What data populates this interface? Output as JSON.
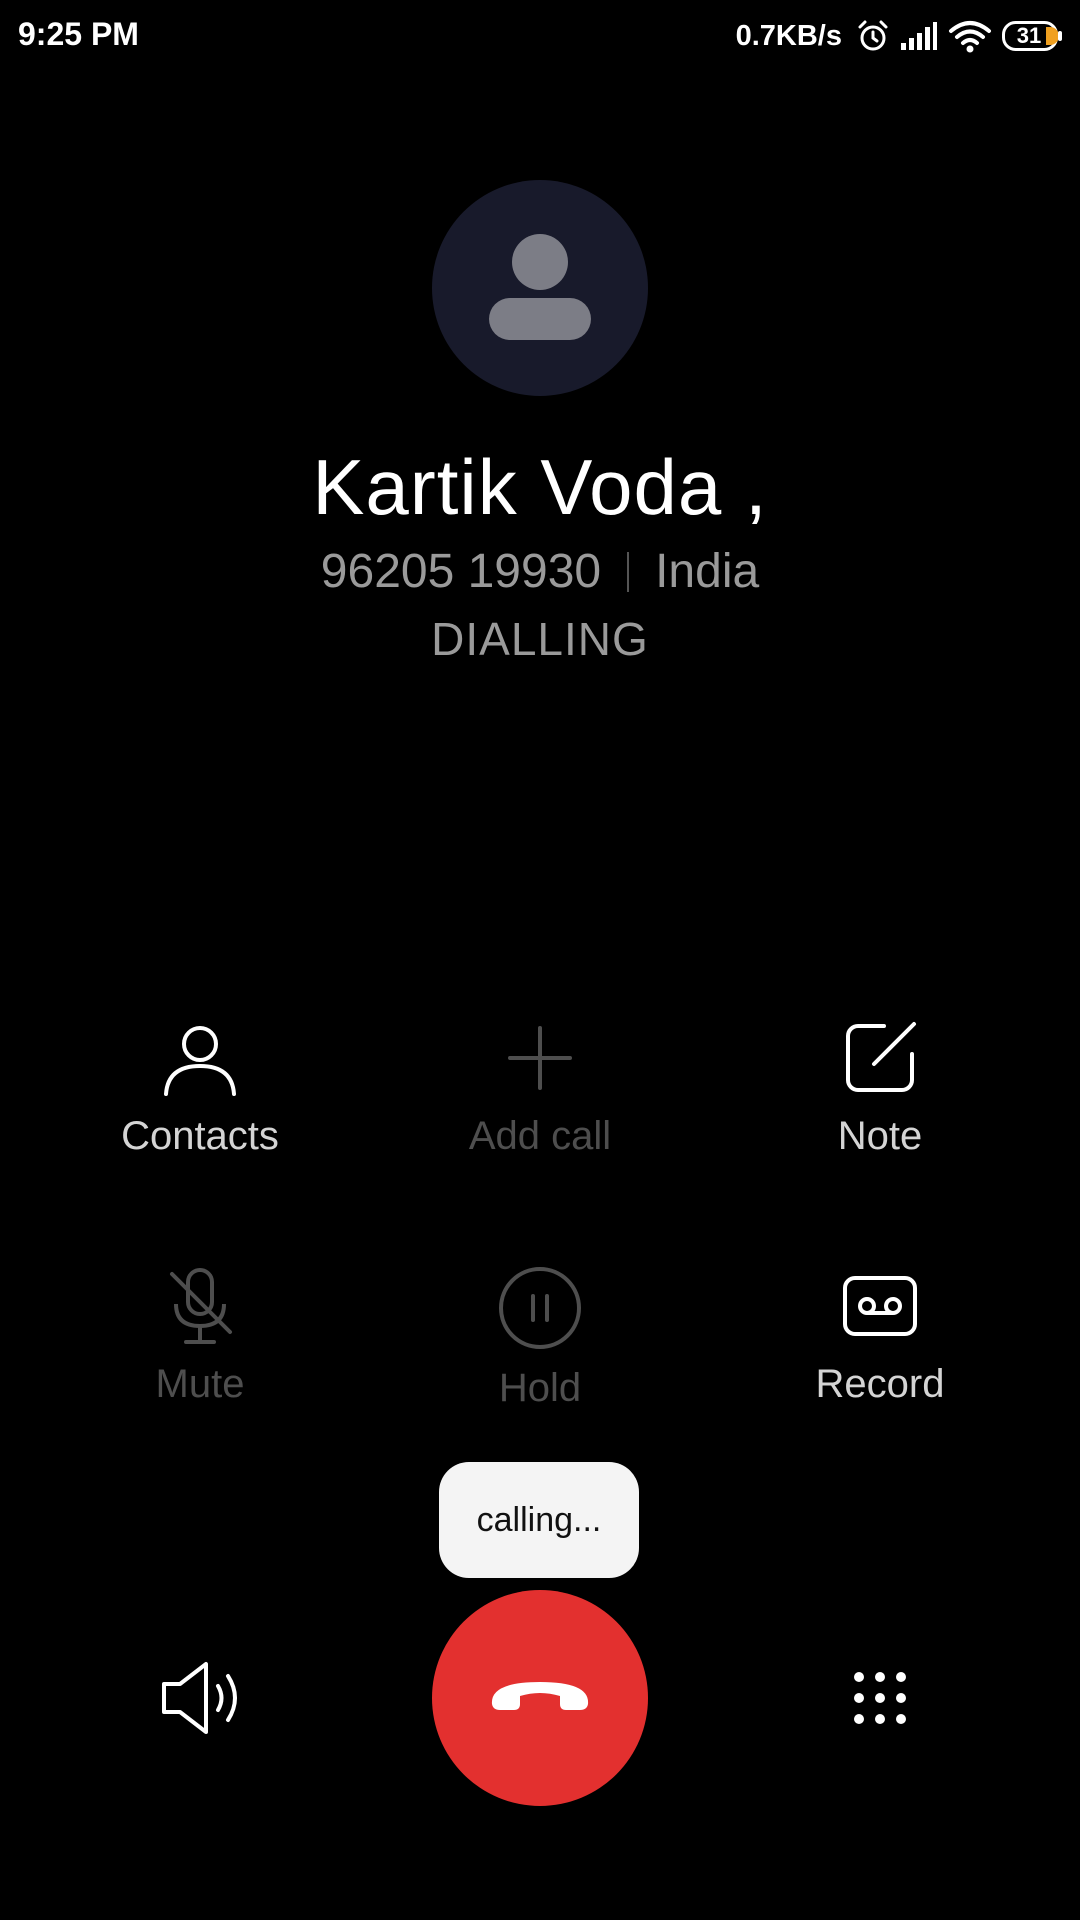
{
  "status_bar": {
    "time": "9:25 PM",
    "network_speed": "0.7KB/s",
    "battery_level": "31",
    "icons": [
      "alarm-icon",
      "signal-icon",
      "wifi-icon",
      "battery-icon"
    ]
  },
  "caller": {
    "name": "Kartik Voda ,",
    "number": "96205 19930",
    "location": "India",
    "status": "DIALLING"
  },
  "actions": {
    "contacts": {
      "label": "Contacts",
      "icon": "person-icon",
      "enabled": true
    },
    "add_call": {
      "label": "Add call",
      "icon": "plus-icon",
      "enabled": false
    },
    "note": {
      "label": "Note",
      "icon": "edit-note-icon",
      "enabled": true
    },
    "mute": {
      "label": "Mute",
      "icon": "mic-off-icon",
      "enabled": false
    },
    "hold": {
      "label": "Hold",
      "icon": "pause-icon",
      "enabled": false
    },
    "record": {
      "label": "Record",
      "icon": "cassette-icon",
      "enabled": true
    }
  },
  "toast": {
    "text": "calling..."
  },
  "bottom": {
    "speaker_icon": "speaker-icon",
    "end_call_icon": "hang-up-icon",
    "dialpad_icon": "dialpad-icon"
  },
  "colors": {
    "background": "#000000",
    "end_call": "#e3302f",
    "avatar_bg": "#181a2b",
    "secondary_text": "#9a9a9a",
    "disabled": "#4e4e4e"
  }
}
